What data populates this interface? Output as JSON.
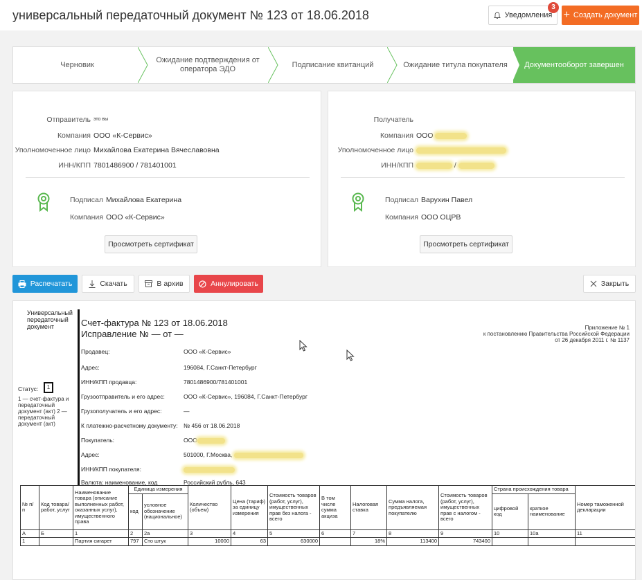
{
  "header": {
    "title": "универсальный передаточный документ № 123 от 18.06.2018",
    "notifications_label": "Уведомления",
    "notifications_count": "3",
    "create_label": "Создать документ"
  },
  "steps": [
    {
      "label": "Черновик"
    },
    {
      "label": "Ожидание подтверждения от оператора ЭДО"
    },
    {
      "label": "Подписание квитанций"
    },
    {
      "label": "Ожидание титула покупателя"
    },
    {
      "label": "Документооборот завершен"
    }
  ],
  "sender": {
    "title_label": "Отправитель",
    "title_note": "это вы",
    "company_label": "Компания",
    "company": "ООО «К-Сервис»",
    "person_label": "Уполномоченное лицо",
    "person": "Михайлова Екатерина Вячеславовна",
    "inn_label": "ИНН/КПП",
    "inn": "7801486900 / 781401001",
    "signed_label": "Подписал",
    "signed": "Михайлова Екатерина",
    "sign_company_label": "Компания",
    "sign_company": "ООО «К-Сервис»",
    "cert_button": "Просмотреть сертификат"
  },
  "receiver": {
    "title_label": "Получатель",
    "company_label": "Компания",
    "company": "ООО",
    "person_label": "Уполномоченное лицо",
    "inn_label": "ИНН/КПП",
    "inn_sep": "/",
    "signed_label": "Подписал",
    "signed": "Варухин Павел",
    "sign_company_label": "Компания",
    "sign_company": "ООО ОЦРВ",
    "cert_button": "Просмотреть сертификат"
  },
  "toolbar": {
    "print": "Распечатать",
    "download": "Скачать",
    "archive": "В архив",
    "annul": "Аннулировать",
    "close": "Закрыть"
  },
  "document": {
    "doc_type": "Универсальный передаточный документ",
    "invoice_title": "Счет-фактура № 123 от 18.06.2018",
    "correction": "Исправление №  — от —",
    "appendix_1": "Приложение № 1",
    "appendix_2": "к постановлению Правительства Российской Федерации",
    "appendix_3": "от 26 декабря 2011 г. № 1137",
    "status_label": "Статус:",
    "status_value": "1",
    "status_note": "1 — счет-фактура и передаточный документ (акт) 2 — передаточный документ (акт)",
    "fields": [
      {
        "label": "Продавец:",
        "value": "ООО «К-Сервис»"
      },
      {
        "label": "Адрес:",
        "value": "196084, Г.Санкт-Петербург"
      },
      {
        "label": "ИНН/КПП продавца:",
        "value": "7801486900/781401001"
      },
      {
        "label": "Грузоотправитель и его адрес:",
        "value": "ООО «К-Сервис», 196084, Г.Санкт-Петербург"
      },
      {
        "label": "Грузополучатель и его адрес:",
        "value": "—"
      },
      {
        "label": "К платежно-расчетному документу:",
        "value": "№ 456 от 18.06.2018"
      },
      {
        "label": "Покупатель:",
        "value": "ООО"
      },
      {
        "label": "Адрес:",
        "value": "501000, Г.Москва,"
      },
      {
        "label": "ИНН/КПП покупателя:",
        "value": ""
      },
      {
        "label": "Валюта: наименование, код",
        "value": "Российский рубль, 643"
      }
    ],
    "table": {
      "h_num": "№ п/ п",
      "h_code": "Код товара/ работ, услуг",
      "h_name": "Наименование товара (описание выполненных работ, оказанных услуг), имущественного права",
      "h_unit": "Единица измерения",
      "h_unit_code": "код",
      "h_unit_name": "условное обозначение (национальное)",
      "h_qty": "Количество (объем)",
      "h_price": "Цена (тариф) за единицу измерения",
      "h_cost": "Стоимость товаров (работ, услуг), имущественных прав без налога - всего",
      "h_excise": "В том числе сумма акциза",
      "h_rate": "Налоговая ставка",
      "h_tax": "Сумма налога, предъявляемая покупателю",
      "h_total": "Стоимость товаров (работ, услуг), имущественных прав с налогом - всего",
      "h_country": "Страна происхождения товара",
      "h_country_code": "цифровой код",
      "h_country_name": "краткое наименование",
      "h_decl": "Номер таможенной декларации",
      "idx": [
        "А",
        "Б",
        "1",
        "2",
        "2а",
        "3",
        "4",
        "5",
        "6",
        "7",
        "8",
        "9",
        "10",
        "10а",
        "11"
      ],
      "row": [
        "1",
        "",
        "Партия сигарет",
        "797",
        "Сто штук",
        "10000",
        "63",
        "630000",
        "",
        "18%",
        "113400",
        "743400",
        "",
        "",
        ""
      ]
    }
  }
}
